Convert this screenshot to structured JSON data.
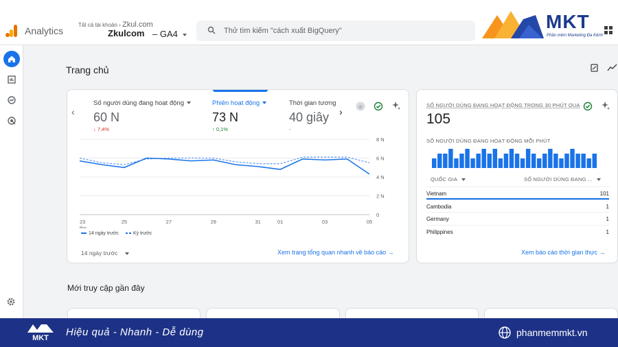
{
  "header": {
    "app_name": "Analytics",
    "account_label": "Tất cả tài khoản",
    "account_name": "Zkul.com",
    "property_name": "Zkulcom",
    "property_suffix": "– GA4",
    "search_placeholder": "Thử tìm kiếm \"cách xuất BigQuery\""
  },
  "brand": {
    "name": "MKT",
    "tagline": "Phần mềm Marketing Đa Kênh",
    "accent_color": "#f7941d",
    "primary_color": "#1b3a8c"
  },
  "nav": {
    "items": [
      "home-icon",
      "reports-icon",
      "explore-icon",
      "advertising-icon"
    ],
    "settings": "gear-icon"
  },
  "page": {
    "title": "Trang chủ",
    "recent_title": "Mới truy cập gần đây"
  },
  "overview": {
    "metrics": [
      {
        "label": "Số người dùng đang hoạt động",
        "value": "60 N",
        "change": "7,4%",
        "direction": "down"
      },
      {
        "label": "Phiên hoạt động",
        "value": "73 N",
        "change": "0,1%",
        "direction": "up"
      },
      {
        "label": "Thời gian tương",
        "value": "40 giây",
        "change": "-",
        "direction": "none"
      }
    ],
    "legend_current": "14 ngày trước",
    "legend_previous": "Kỳ trước",
    "range_label": "14 ngày trước",
    "link_label": "Xem trang tổng quan nhanh về báo cáo"
  },
  "chart_data": {
    "type": "line",
    "x": [
      "23 thg",
      "24",
      "25",
      "26",
      "27",
      "28",
      "29",
      "30",
      "31",
      "01",
      "02",
      "03",
      "04",
      "05"
    ],
    "x_tick_labels": [
      "23",
      "25",
      "27",
      "29",
      "31",
      "01",
      "03",
      "05"
    ],
    "x_tick_sub": "thg",
    "y_ticks": [
      "8 N",
      "6 N",
      "4 N",
      "2 N",
      "0"
    ],
    "ylim": [
      0,
      8000
    ],
    "series": [
      {
        "name": "14 ngày trước",
        "style": "solid",
        "values": [
          5700,
          5300,
          5000,
          6000,
          5900,
          5700,
          5800,
          5300,
          5100,
          4800,
          5900,
          5800,
          5900,
          4300
        ]
      },
      {
        "name": "Kỳ trước",
        "style": "dashed",
        "values": [
          6000,
          5500,
          5300,
          5900,
          6000,
          6000,
          6000,
          5600,
          5400,
          5400,
          6100,
          6100,
          6100,
          5500
        ]
      }
    ],
    "grid": true,
    "legend_position": "bottom-left"
  },
  "realtime": {
    "title": "SỐ NGƯỜI DÙNG ĐANG HOẠT ĐỘNG TRONG 30 PHÚT QUA",
    "value": "105",
    "subtitle": "SỐ NGƯỜI DÙNG ĐANG HOẠT ĐỘNG MỖI PHÚT",
    "per_minute": [
      2,
      3,
      3,
      4,
      2,
      3,
      4,
      2,
      3,
      4,
      3,
      4,
      2,
      3,
      4,
      3,
      2,
      4,
      3,
      2,
      3,
      4,
      3,
      2,
      3,
      4,
      3,
      3,
      2,
      3
    ],
    "col_country": "QUỐC GIA",
    "col_users": "SỐ NGƯỜI DÙNG ĐANG ...",
    "rows": [
      {
        "country": "Vietnam",
        "users": "101",
        "share": 1.0
      },
      {
        "country": "Cambodia",
        "users": "1",
        "share": 0.0
      },
      {
        "country": "Germany",
        "users": "1",
        "share": 0.0
      },
      {
        "country": "Philippines",
        "users": "1",
        "share": 0.0
      }
    ],
    "link_label": "Xem báo cáo thời gian thực"
  },
  "footer": {
    "tagline": "Hiệu quả - Nhanh - Dễ dùng",
    "url": "phanmemmkt.vn",
    "logo_text": "MKT"
  }
}
